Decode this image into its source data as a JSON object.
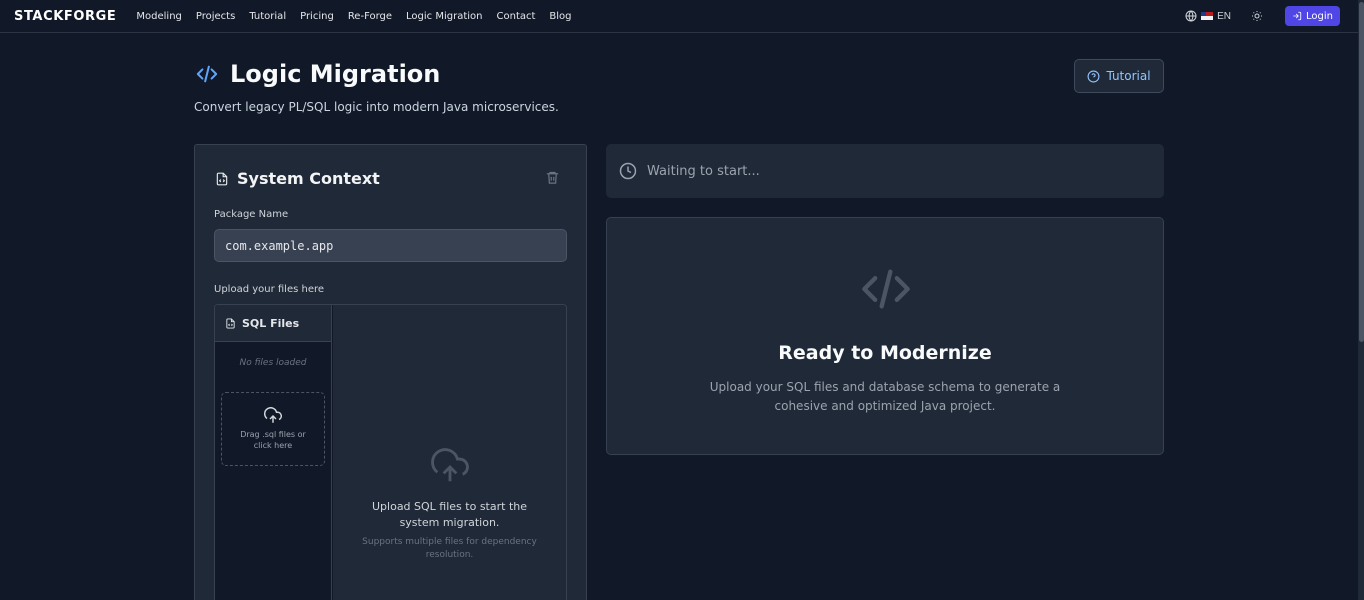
{
  "brand": "STACKFORGE",
  "nav": [
    "Modeling",
    "Projects",
    "Tutorial",
    "Pricing",
    "Re-Forge",
    "Logic Migration",
    "Contact",
    "Blog"
  ],
  "topbar": {
    "language": "EN",
    "login_label": "Login"
  },
  "page": {
    "title": "Logic Migration",
    "subtitle": "Convert legacy PL/SQL logic into modern Java microservices.",
    "tutorial_label": "Tutorial"
  },
  "context": {
    "title": "System Context",
    "package_label": "Package Name",
    "package_value": "com.example.app",
    "upload_label": "Upload your files here",
    "files_header": "SQL Files",
    "no_files": "No files loaded",
    "drop_small": "Drag .sql files or click here",
    "drop_main": "Upload SQL files to start the system migration.",
    "drop_hint": "Supports multiple files for dependency resolution."
  },
  "status": {
    "text": "Waiting to start..."
  },
  "ready": {
    "title": "Ready to Modernize",
    "description": "Upload your SQL files and database schema to generate a cohesive and optimized Java project."
  },
  "colors": {
    "accent": "#4f46e5",
    "brand_blue": "#60a5fa",
    "background": "#111827",
    "panel": "#1f2937"
  },
  "icons": [
    "globe-icon",
    "us-flag-icon",
    "sun-icon",
    "login-icon",
    "code-icon",
    "help-circle-icon",
    "file-code-icon",
    "trash-icon",
    "cloud-upload-icon",
    "clock-icon"
  ]
}
